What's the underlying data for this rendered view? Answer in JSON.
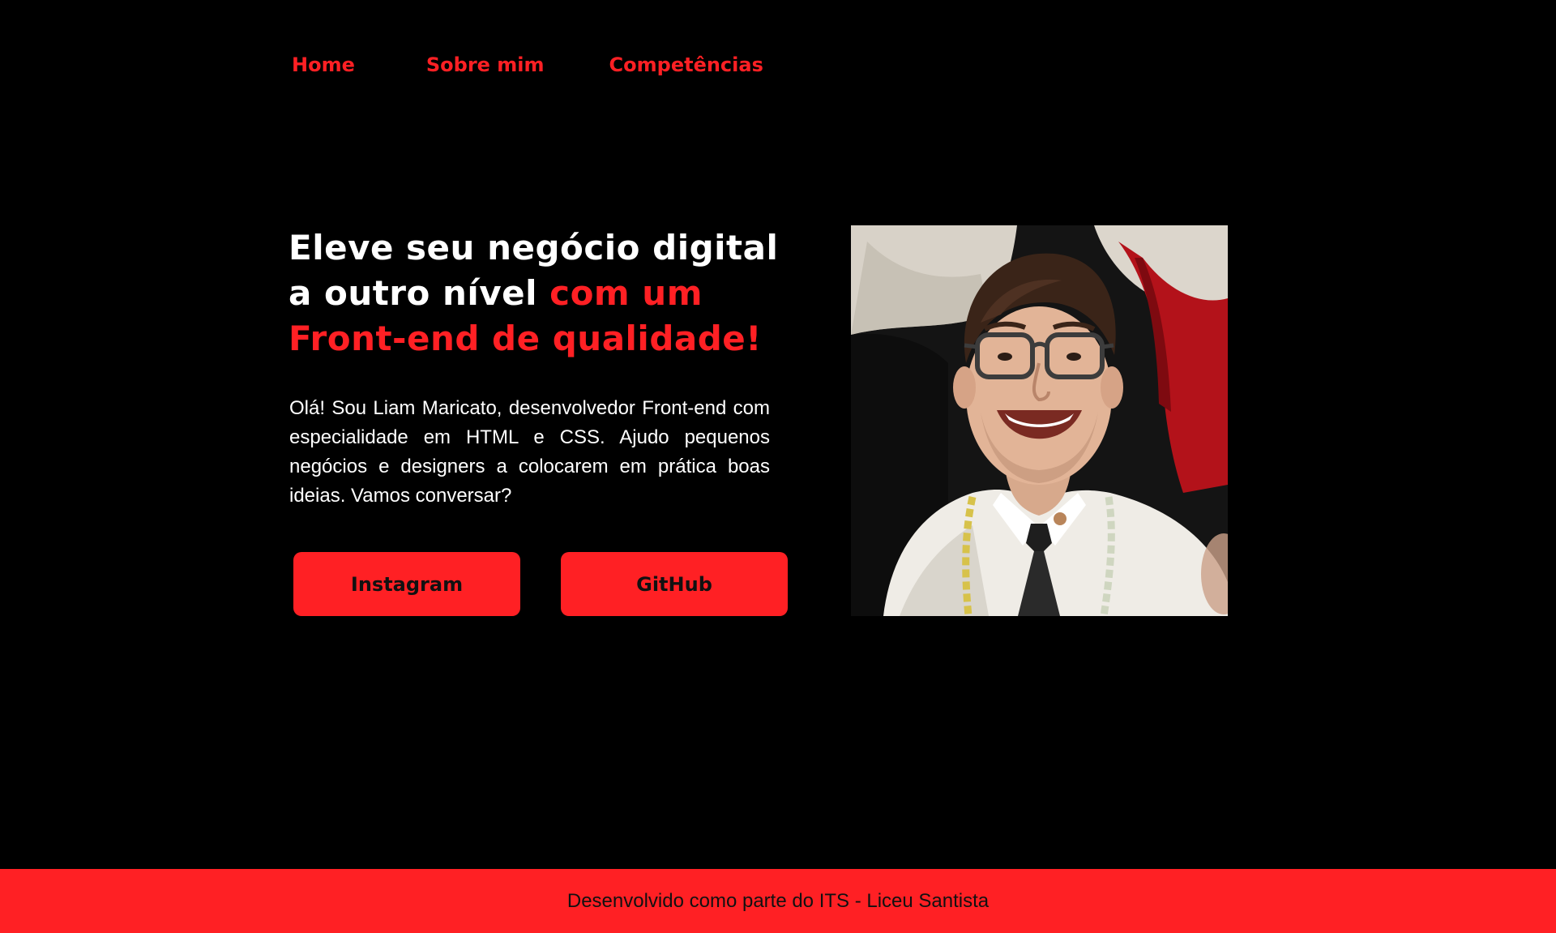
{
  "nav": {
    "items": [
      {
        "label": "Home"
      },
      {
        "label": "Sobre mim"
      },
      {
        "label": "Competências"
      }
    ]
  },
  "hero": {
    "title_line1": "Eleve seu negócio digital",
    "title_line2_white": "a outro nível",
    "title_line2_accent": "com um",
    "title_line3_accent": "Front-end de qualidade!",
    "intro": "Olá! Sou Liam Maricato, desenvolvedor Front-end com especialidade em HTML e CSS. Ajudo pequenos negócios e designers a colocarem em prática boas ideias. Vamos conversar?",
    "buttons": {
      "instagram": "Instagram",
      "github": "GitHub"
    },
    "photo_icon": "profile-photo"
  },
  "footer": {
    "text": "Desenvolvido como parte do ITS - Liceu Santista"
  },
  "colors": {
    "background": "#000000",
    "accent": "#ff2024",
    "text": "#ffffff",
    "button_text": "#111111"
  }
}
